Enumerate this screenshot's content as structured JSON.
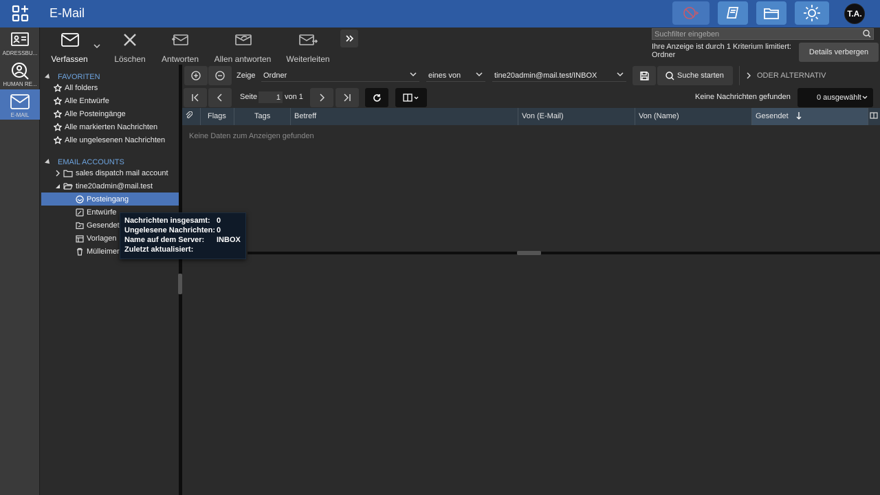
{
  "app": {
    "title": "E-Mail"
  },
  "user": {
    "initials": "T.A."
  },
  "modules": [
    {
      "label": "ADRESSBU..."
    },
    {
      "label": "HUMAN RE..."
    },
    {
      "label": "E-MAIL"
    }
  ],
  "toolbar": {
    "compose": "Verfassen",
    "delete": "Löschen",
    "reply": "Antworten",
    "reply_all": "Allen antworten",
    "forward": "Weiterleiten"
  },
  "search": {
    "placeholder": "Suchfilter eingeben"
  },
  "filter_note": "Ihre Anzeige ist durch 1 Kriterium limitiert: Ordner",
  "details_button": "Details verbergen",
  "tree": {
    "favorites_title": "FAVORITEN",
    "favorites": [
      "All folders",
      "Alle Entwürfe",
      "Alle Posteingänge",
      "Alle markierten Nachrichten",
      "Alle ungelesenen Nachrichten"
    ],
    "accounts_title": "EMAIL ACCOUNTS",
    "account1": "sales dispatch mail account",
    "account2": "tine20admin@mail.test",
    "folders": [
      "Posteingang",
      "Entwürfe",
      "Gesendet",
      "Vorlagen",
      "Mülleimer"
    ]
  },
  "filter": {
    "show_label": "Zeige",
    "field": "Ordner",
    "operator": "eines von",
    "value": "tine20admin@mail.test/INBOX",
    "search_button": "Suche starten",
    "or_alt": "ODER ALTERNATIV"
  },
  "paging": {
    "page_label": "Seite",
    "page": "1",
    "of_label": "von 1",
    "status": "Keine Nachrichten gefunden",
    "selected": "0 ausgewählt"
  },
  "grid": {
    "columns": [
      "Flags",
      "Tags",
      "Betreff",
      "Von (E-Mail)",
      "Von (Name)",
      "Gesendet"
    ],
    "empty": "Keine Daten zum Anzeigen gefunden"
  },
  "tooltip": {
    "rows": [
      {
        "k": "Nachrichten insgesamt:",
        "v": "0"
      },
      {
        "k": "Ungelesene Nachrichten:",
        "v": "0"
      },
      {
        "k": "Name auf dem Server:",
        "v": "INBOX"
      },
      {
        "k": "Zuletzt aktualisiert:",
        "v": ""
      }
    ]
  },
  "colors": {
    "topbar": "#2d5ba3",
    "accent": "#4a74b8",
    "section": "#6ea4df"
  }
}
